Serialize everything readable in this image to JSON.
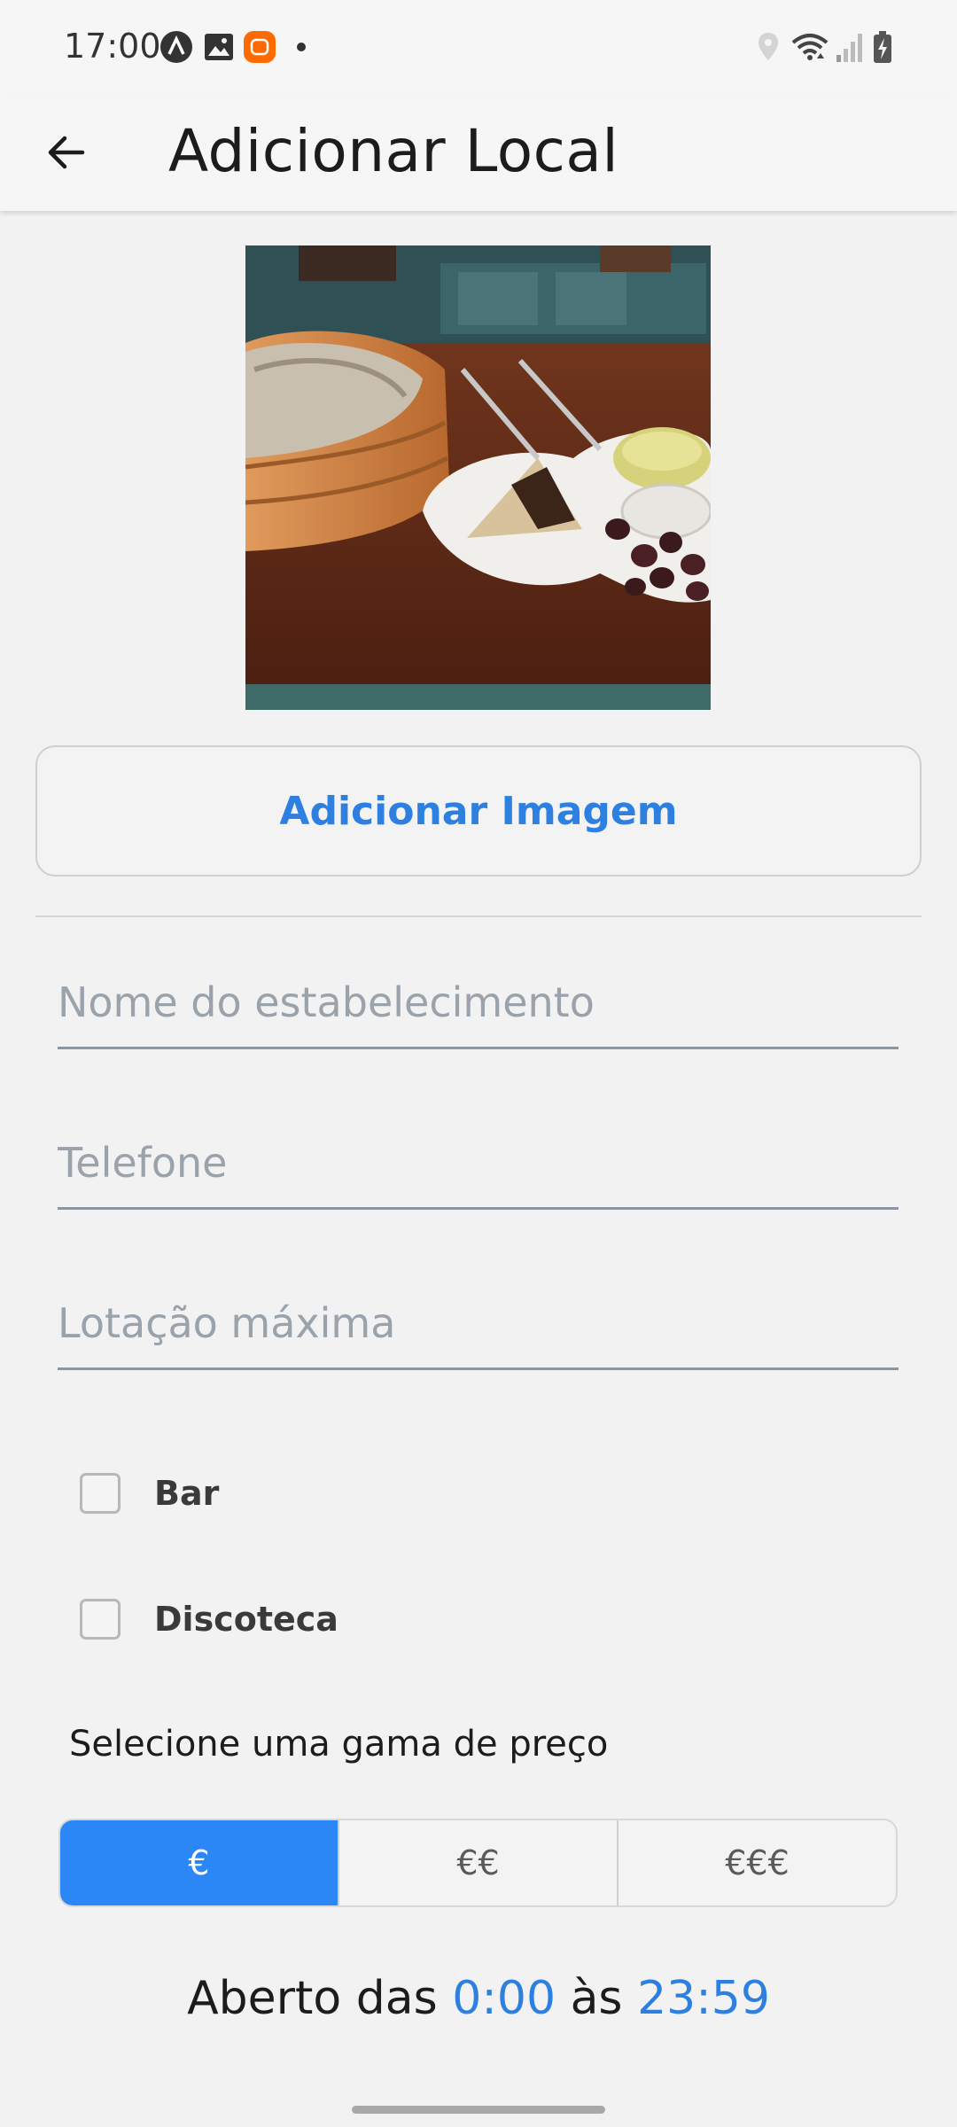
{
  "status_bar": {
    "time": "17:00",
    "left_icons": [
      "a-logo-icon",
      "gallery-icon",
      "mi-app-icon",
      "dot-icon"
    ],
    "right_icons": [
      "location-icon",
      "wifi-icon",
      "signal-icon",
      "battery-charging-icon"
    ]
  },
  "app_bar": {
    "title": "Adicionar Local",
    "back_icon": "arrow-left-icon"
  },
  "photo": {
    "description_icon": "food-photo"
  },
  "add_image_label": "Adicionar Imagem",
  "form": {
    "name_placeholder": "Nome do estabelecimento",
    "name_value": "",
    "phone_placeholder": "Telefone",
    "phone_value": "",
    "capacity_placeholder": "Lotação máxima",
    "capacity_value": ""
  },
  "categories": [
    {
      "label": "Bar",
      "checked": false
    },
    {
      "label": "Discoteca",
      "checked": false
    }
  ],
  "price": {
    "label": "Selecione uma gama de preço",
    "options": [
      "€",
      "€€",
      "€€€"
    ],
    "selected": "€"
  },
  "hours": {
    "prefix": "Aberto das",
    "open": "0:00",
    "middle": "às",
    "close": "23:59"
  },
  "colors": {
    "accent": "#2b87f5",
    "link": "#2d7fe0"
  }
}
